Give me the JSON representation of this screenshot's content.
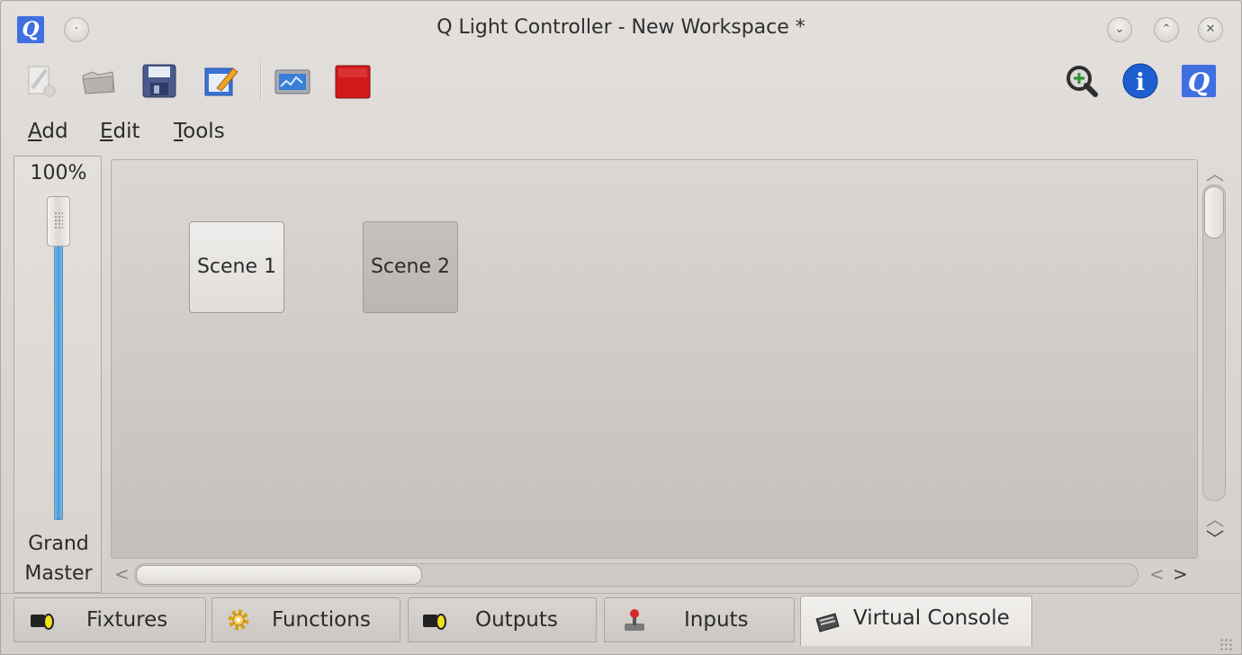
{
  "window": {
    "title": "Q Light Controller - New Workspace *",
    "app_icon_letter": "Q",
    "controls": {
      "minimize": "⌄",
      "maximize": "⌃",
      "close": "✕",
      "menu": "·"
    }
  },
  "toolbar": {
    "buttons": [
      "new-workspace",
      "open-workspace",
      "save-workspace",
      "design-mode",
      "monitor",
      "stop-all-functions"
    ],
    "right_buttons": [
      "control-monitor",
      "about",
      "qlc-info"
    ],
    "about_glyph": "i",
    "q_glyph": "Q"
  },
  "menu": {
    "items": [
      {
        "underline": "A",
        "rest": "dd"
      },
      {
        "underline": "E",
        "rest": "dit"
      },
      {
        "underline": "T",
        "rest": "ools"
      }
    ]
  },
  "grand_master": {
    "value": "100%",
    "level": 1.0,
    "label_line1": "Grand",
    "label_line2": "Master"
  },
  "virtual_console": {
    "buttons": [
      {
        "label": "Scene 1",
        "active": false
      },
      {
        "label": "Scene 2",
        "active": true
      }
    ]
  },
  "scrollbars": {
    "up": "︿",
    "down": "﹀",
    "left": "<",
    "right": ">"
  },
  "tabs": [
    {
      "label": "Fixtures",
      "active": false
    },
    {
      "label": "Functions",
      "active": false
    },
    {
      "label": "Outputs",
      "active": false
    },
    {
      "label": "Inputs",
      "active": false
    },
    {
      "label": "Virtual Console",
      "active": true
    }
  ],
  "colors": {
    "accent": "#3f6fe0",
    "stop_red": "#d11a1a",
    "grand_master_fill": "#4a98d4"
  }
}
